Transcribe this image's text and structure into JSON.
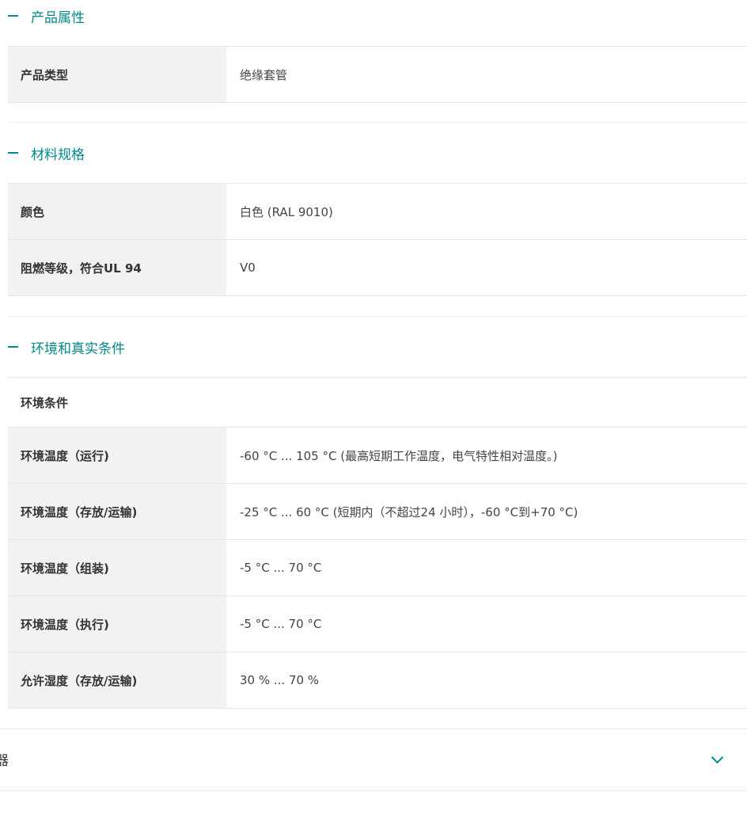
{
  "sections": [
    {
      "title": "产品属性",
      "rows": [
        {
          "key": "产品类型",
          "value": "绝缘套管"
        }
      ]
    },
    {
      "title": "材料规格",
      "rows": [
        {
          "key": "颜色",
          "value": "白色 (RAL 9010)"
        },
        {
          "key": "阻燃等级，符合UL 94",
          "value": "V0"
        }
      ]
    },
    {
      "title": "环境和真实条件",
      "subheading": "环境条件",
      "rows": [
        {
          "key": "环境温度（运行)",
          "value": "-60 °C ... 105 °C (最高短期工作温度，电气特性相对温度。)"
        },
        {
          "key": "环境温度（存放/运输)",
          "value": "-25 °C ... 60 °C (短期内（不超过24  小时），-60 °C到+70 °C)"
        },
        {
          "key": "环境温度（组装)",
          "value": "-5 °C ... 70 °C"
        },
        {
          "key": "环境温度（执行)",
          "value": "-5 °C ... 70 °C"
        },
        {
          "key": "允许湿度（存放/运输)",
          "value": "30 % ... 70 %"
        }
      ]
    }
  ],
  "collapsed_section": {
    "visible_glyph": "器",
    "icon": "chevron-down-icon"
  },
  "colors": {
    "accent": "#00898b",
    "key_bg": "#f2f2f2"
  }
}
